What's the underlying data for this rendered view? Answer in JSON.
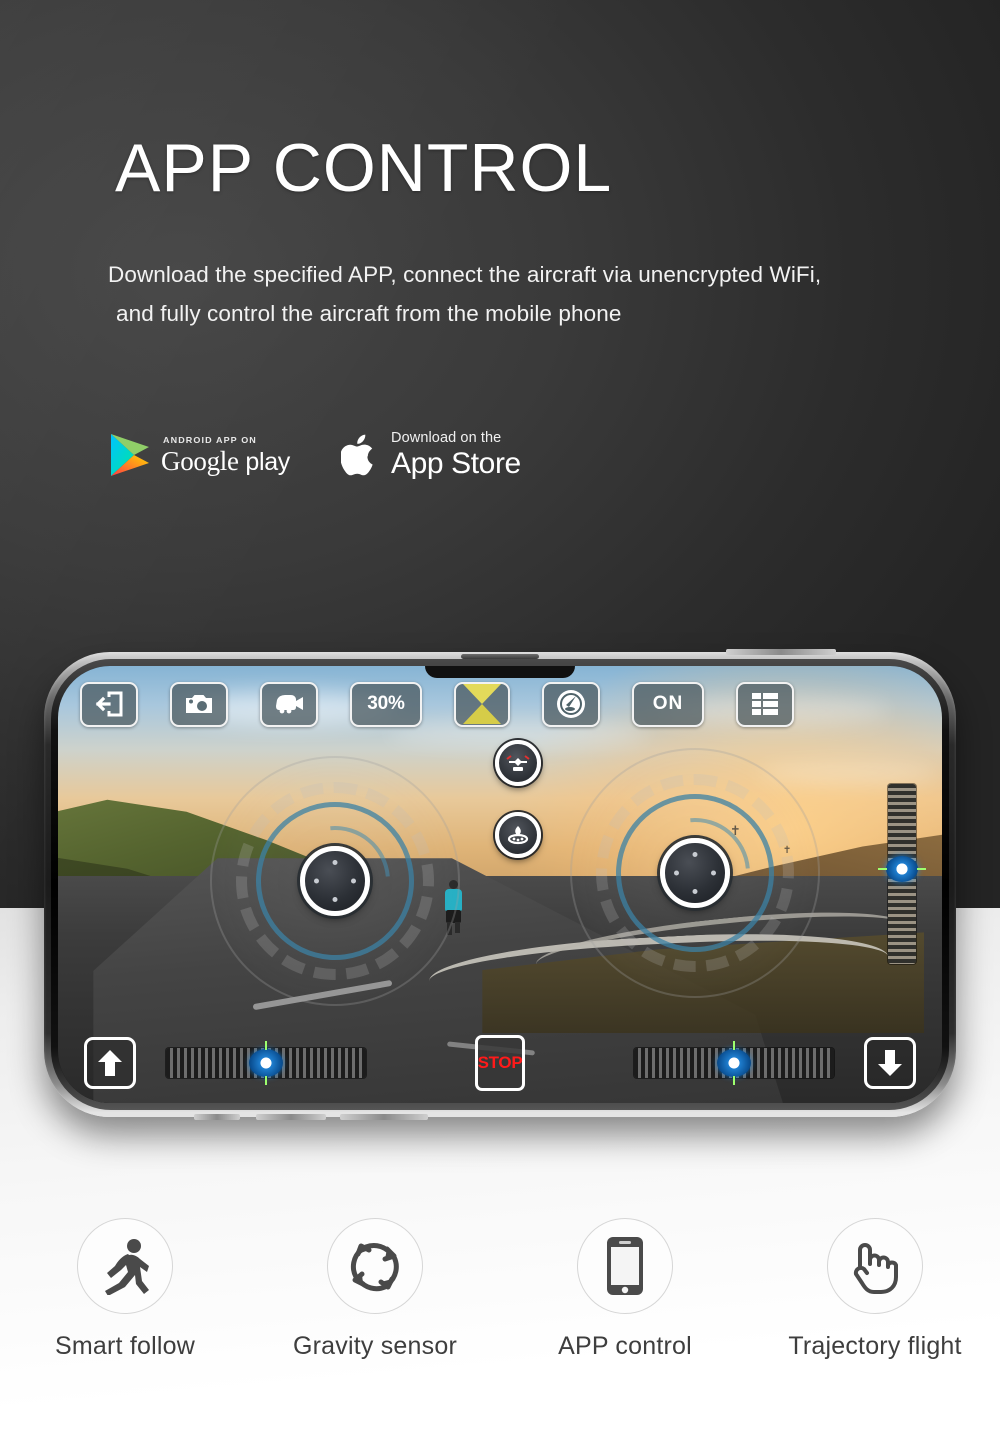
{
  "hero": {
    "title": "APP CONTROL",
    "subtitle_line1": "Download the specified APP, connect the aircraft via unencrypted WiFi,",
    "subtitle_line2": "and fully control the aircraft from the mobile phone",
    "bg_color_left": "#3e3e3e",
    "bg_color_right": "#262626",
    "title_color": "#ffffff"
  },
  "store_badges": [
    {
      "id": "google-play",
      "small_text": "ANDROID APP ON",
      "large_text": "Google",
      "large_text_2": "play",
      "icon": "google-play-triangle-icon"
    },
    {
      "id": "app-store",
      "small_text": "Download on the",
      "large_text": "App Store",
      "icon": "apple-logo-icon"
    }
  ],
  "phone_app": {
    "toolbar": [
      {
        "name": "exit-button",
        "icon": "exit-arrow-icon",
        "label": ""
      },
      {
        "name": "photo-button",
        "icon": "camera-icon",
        "label": ""
      },
      {
        "name": "video-button",
        "icon": "video-camera-icon",
        "label": ""
      },
      {
        "name": "battery-indicator",
        "icon": "percent-text",
        "label": "30%"
      },
      {
        "name": "hourglass-button",
        "icon": "hourglass-icon",
        "label": ""
      },
      {
        "name": "speed-gauge-button",
        "icon": "speed-gauge-icon",
        "label": ""
      },
      {
        "name": "power-toggle",
        "icon": "on-text",
        "label": "ON"
      },
      {
        "name": "menu-button",
        "icon": "grid-menu-icon",
        "label": ""
      }
    ],
    "center_buttons": [
      {
        "name": "takeoff-button",
        "icon": "drone-takeoff-icon"
      },
      {
        "name": "landing-button",
        "icon": "drone-landing-icon"
      }
    ],
    "bottom_bar": {
      "ascend_label": "",
      "descend_label": "",
      "stop_label": "STOP",
      "ascend_icon": "up-arrow-icon",
      "descend_icon": "down-arrow-icon"
    },
    "joysticks": [
      {
        "name": "left-joystick",
        "icon": "joystick-icon"
      },
      {
        "name": "right-joystick",
        "icon": "joystick-icon"
      }
    ],
    "sliders": {
      "left_trim": 50,
      "right_trim": 50,
      "vertical_throttle": 47
    },
    "accent_color": "#1f7fd0"
  },
  "features": [
    {
      "label": "Smart follow",
      "icon": "running-person-icon"
    },
    {
      "label": "Gravity sensor",
      "icon": "circular-arrows-icon"
    },
    {
      "label": "APP control",
      "icon": "smartphone-icon"
    },
    {
      "label": "Trajectory flight",
      "icon": "pointing-hand-icon"
    }
  ]
}
